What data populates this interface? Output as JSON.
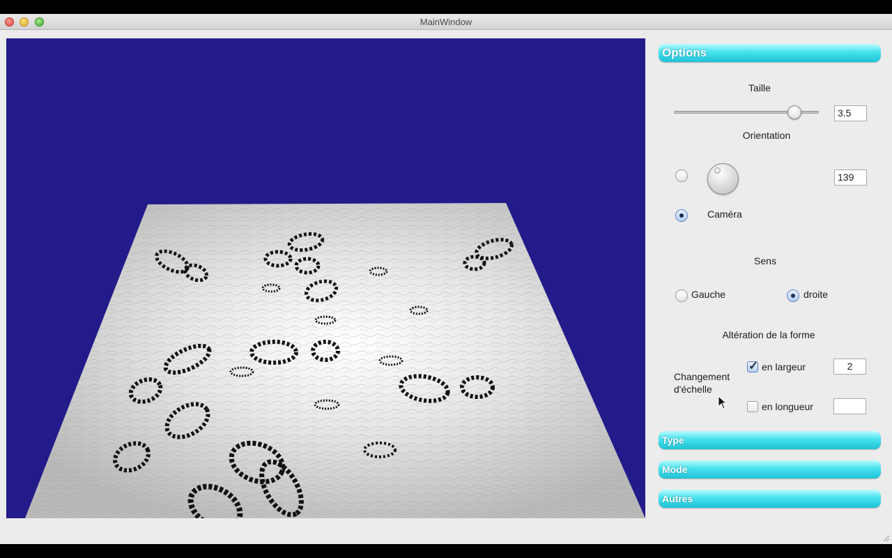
{
  "window": {
    "title": "MainWindow"
  },
  "viewport": {
    "background_color": "#231b8a",
    "floor_color": "#d9d9d9"
  },
  "panel": {
    "options": {
      "header": "Options",
      "size": {
        "label": "Taille",
        "value": "3.5",
        "slider_fraction": 0.83
      },
      "orientation": {
        "label": "Orientation",
        "dial_value": "139",
        "dial_selected": false,
        "camera_label": "Caméra",
        "camera_selected": true
      },
      "direction": {
        "label": "Sens",
        "left_label": "Gauche",
        "left_selected": false,
        "right_label": "droite",
        "right_selected": true
      },
      "shape_alteration": {
        "label": "Altération de la forme",
        "scale_change_label_line1": "Changement",
        "scale_change_label_line2": "d'échelle",
        "width_label": "en largeur",
        "width_checked": true,
        "width_value": "2",
        "length_label": "en longueur",
        "length_checked": false,
        "length_value": ""
      }
    },
    "sections": {
      "type": "Type",
      "mode": "Mode",
      "others": "Autres"
    },
    "accent_color": "#3fd8e8"
  }
}
